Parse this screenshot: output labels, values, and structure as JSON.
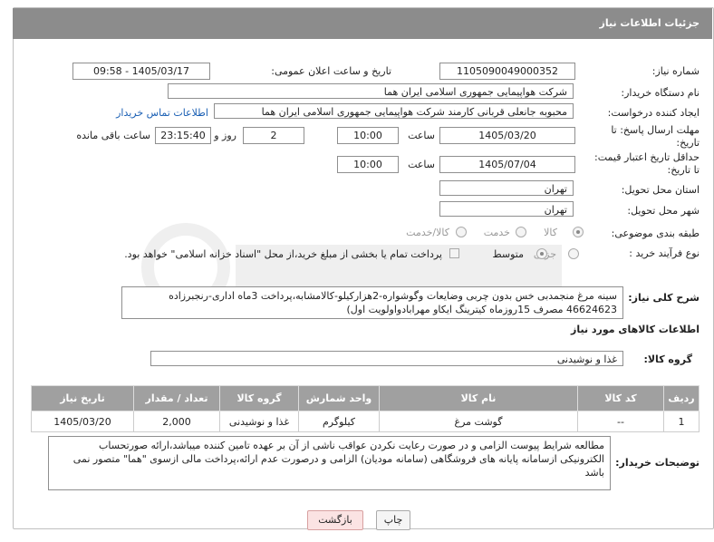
{
  "header": {
    "title": "جزئیات اطلاعات نیاز"
  },
  "need_number": {
    "label": "شماره نیاز:",
    "value": "1105090049000352"
  },
  "announce": {
    "label": "تاریخ و ساعت اعلان عمومی:",
    "value": "1405/03/17 - 09:58"
  },
  "buyer_org": {
    "label": "نام دستگاه خریدار:",
    "value": "شرکت هواپیمایی جمهوری اسلامی ایران هما"
  },
  "creator": {
    "label": "ایجاد کننده درخواست:",
    "value": "محبوبه جانعلی قربانی کارمند شرکت هواپیمایی جمهوری اسلامی ایران هما",
    "contact_link": "اطلاعات تماس خریدار"
  },
  "reply_deadline": {
    "label_line1": "مهلت ارسال پاسخ: تا",
    "label_line2": "تاریخ:",
    "date": "1405/03/20",
    "time_label": "ساعت",
    "time": "10:00",
    "days": "2",
    "days_label": "روز و",
    "remaining": "23:15:40",
    "remaining_label": "ساعت باقی مانده"
  },
  "price_validity": {
    "label_line1": "حداقل تاریخ اعتبار قیمت:",
    "label_line2": "تا تاریخ:",
    "date": "1405/07/04",
    "time_label": "ساعت",
    "time": "10:00"
  },
  "province": {
    "label": "استان محل تحویل:",
    "value": "تهران"
  },
  "city": {
    "label": "شهر محل تحویل:",
    "value": "تهران"
  },
  "category": {
    "label": "طبقه بندی موضوعی:",
    "options": [
      "کالا",
      "خدمت",
      "کالا/خدمت"
    ],
    "selected": "کالا"
  },
  "purchase_type": {
    "label": "نوع فرآیند خرید :",
    "options": [
      "جزیی",
      "متوسط"
    ],
    "selected": "متوسط",
    "note": "پرداخت تمام یا بخشی از مبلغ خرید،از محل \"اسناد خزانه اسلامی\" خواهد بود."
  },
  "description": {
    "label": "شرح کلی نیاز:",
    "text": "سینه مرغ منجمدبی خس بدون چربی وضایعات وگوشواره-2هزارکیلو-کالامشابه،پرداخت 3ماه اداری-رنجبرزاده 46624623 مصرف 15روزماه کیترینگ ایکاو مهرابادواولویت اول)"
  },
  "goods_info": {
    "title": "اطلاعات کالاهای مورد نیاز"
  },
  "goods_group": {
    "label": "گروه کالا:",
    "value": "غذا و نوشیدنی"
  },
  "table": {
    "headers": [
      "ردیف",
      "کد کالا",
      "نام کالا",
      "واحد شمارش",
      "گروه کالا",
      "تعداد / مقدار",
      "تاریخ نیاز"
    ],
    "rows": [
      [
        "1",
        "--",
        "گوشت مرغ",
        "کیلوگرم",
        "غذا و نوشیدنی",
        "2,000",
        "1405/03/20"
      ]
    ]
  },
  "buyer_notes": {
    "label": "توضیحات خریدار:",
    "text": "مطالعه شرایط پیوست الزامی و در صورت رعایت نکردن عواقب ناشی از آن بر عهده تامین کننده میباشد،ارائه صورتحساب الکترونیکی ازسامانه پایانه های فروشگاهی (سامانه مودیان) الزامی و درصورت عدم ارائه،پرداخت مالی ازسوی \"هما\" متصور نمی باشد"
  },
  "buttons": {
    "print": "چاپ",
    "back": "بازگشت"
  },
  "colors": {
    "header_bg": "#8c8c8c",
    "table_header_bg": "#a0a0a0",
    "link": "#1a5fb4",
    "back_button_bg": "#fbe3e3"
  }
}
